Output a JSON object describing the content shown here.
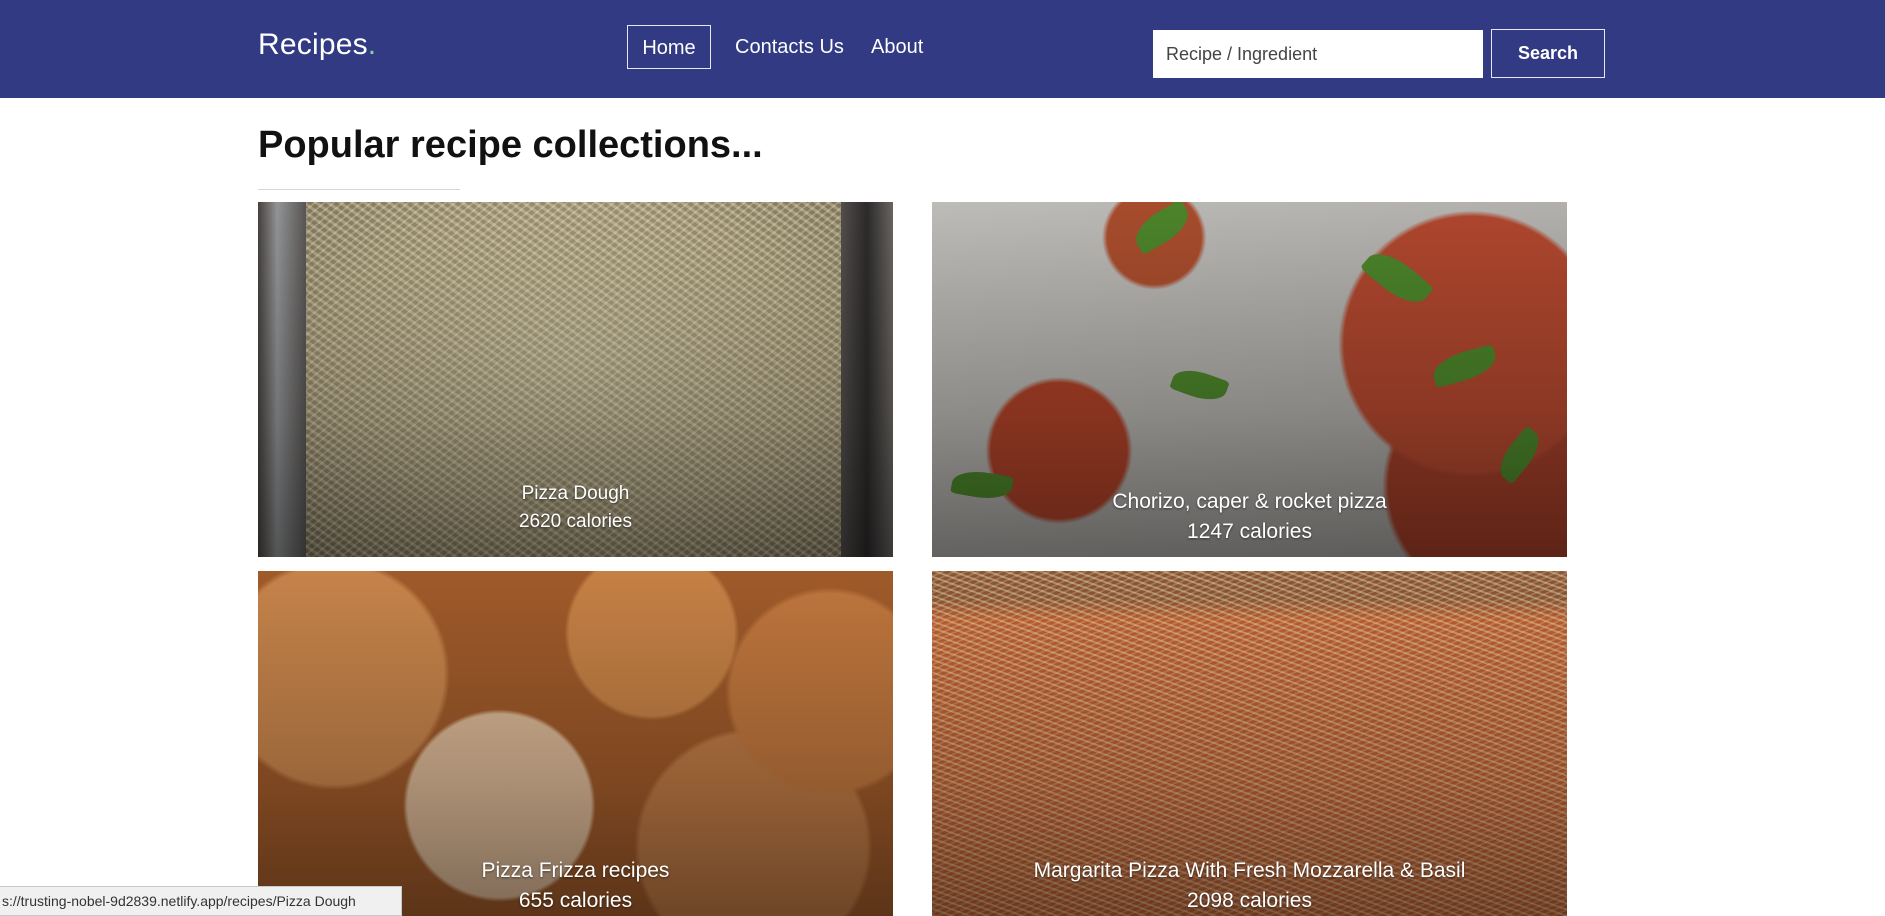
{
  "navbar": {
    "brand": "Recipes",
    "brand_dot": ".",
    "links": [
      {
        "label": "Home",
        "active": true
      },
      {
        "label": "Contacts Us",
        "active": false
      },
      {
        "label": "About",
        "active": false
      }
    ],
    "search": {
      "placeholder": "Recipe / Ingredient",
      "value": "",
      "button_label": "Search"
    }
  },
  "main": {
    "title": "Popular recipe collections...",
    "cards": [
      {
        "name": "Pizza Dough",
        "calories": "2620 calories"
      },
      {
        "name": "Chorizo, caper & rocket pizza",
        "calories": "1247 calories"
      },
      {
        "name": "Pizza Frizza recipes",
        "calories": "655 calories"
      },
      {
        "name": "Margarita Pizza With Fresh Mozzarella & Basil",
        "calories": "2098 calories"
      }
    ]
  },
  "status_bar": {
    "url": "s://trusting-nobel-9d2839.netlify.app/recipes/Pizza Dough"
  },
  "colors": {
    "navbar": "#313a82",
    "brand_dot": "#8fd0a0",
    "background": "#ffffff"
  }
}
